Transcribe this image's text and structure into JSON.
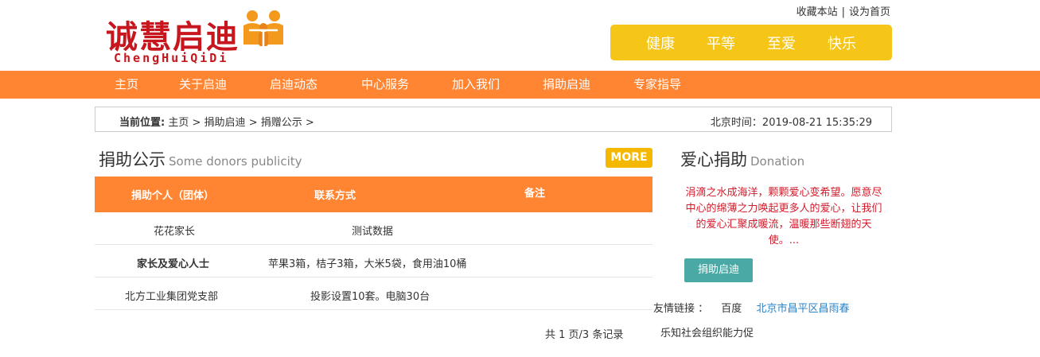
{
  "logo": {
    "cn": "诚慧启迪",
    "en": "ChengHuiQiDi"
  },
  "top_links": {
    "bookmark": "收藏本站",
    "separator": "|",
    "homepage": "设为首页"
  },
  "slogan": [
    "健康",
    "平等",
    "至爱",
    "快乐"
  ],
  "nav": [
    "主页",
    "关于启迪",
    "启迪动态",
    "中心服务",
    "加入我们",
    "捐助启迪",
    "专家指导"
  ],
  "breadcrumb": {
    "label": "当前位置:",
    "items": [
      "主页",
      "捐助启迪",
      "捐赠公示"
    ],
    "arrow": ">",
    "time_label": "北京时间：",
    "time_value": "2019-08-21 15:35:29"
  },
  "publicity": {
    "title_cn": "捐助公示",
    "title_en": "Some donors publicity",
    "more": "MORE",
    "headers": [
      "捐助个人（团体）",
      "联系方式",
      "备注"
    ],
    "rows": [
      {
        "donor": "花花家长",
        "contact": "测试数据",
        "note": "",
        "bold": false
      },
      {
        "donor": "家长及爱心人士",
        "contact": "苹果3箱，桔子3箱，大米5袋，食用油10桶",
        "note": "",
        "bold": true
      },
      {
        "donor": "北方工业集团党支部",
        "contact": "投影设置10套。电脑30台",
        "note": "",
        "bold": false
      }
    ],
    "paging": "共 1 页/3 条记录"
  },
  "donation": {
    "title_cn": "爱心捐助",
    "title_en": "Donation",
    "text": "涓滴之水成海洋，颗颗爱心变希望。愿意尽中心的绵薄之力唤起更多人的爱心，让我们的爱心汇聚成暖流，温暖那些断翅的天使。...",
    "button": "捐助启迪"
  },
  "friend_links": {
    "label": "友情链接 ：",
    "items": [
      "百度",
      "北京市昌平区昌雨春",
      "乐知社会组织能力促"
    ]
  },
  "colors": {
    "nav_bg": "#ff8533",
    "slogan_bg": "#f5c518",
    "more_bg": "#f5b800",
    "logo_red": "#c7161e",
    "donate_text": "#d31a2a",
    "donate_btn": "#4aa9a4",
    "link_blue": "#2a84c8"
  }
}
